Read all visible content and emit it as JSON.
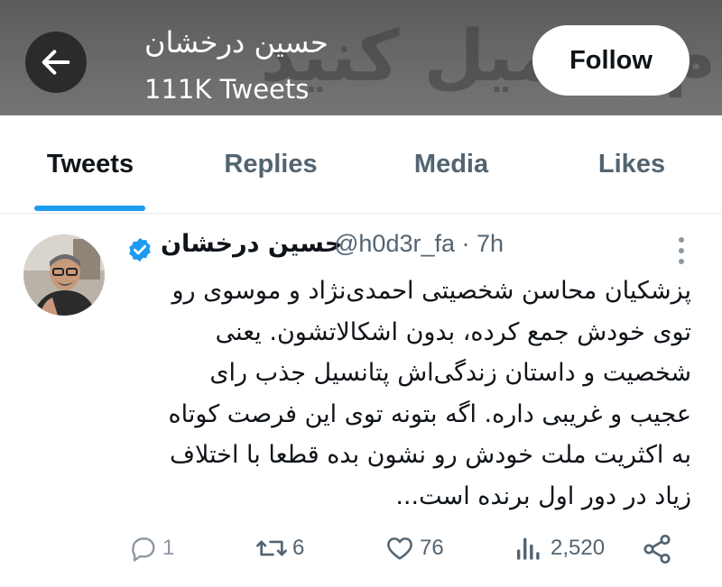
{
  "header": {
    "banner_text": "ام تحمیل کنید",
    "back_icon": "arrow-left-icon",
    "name": "حسین درخشان",
    "tweet_count": "111K Tweets",
    "follow_label": "Follow"
  },
  "tabs": [
    {
      "label": "Tweets",
      "active": true
    },
    {
      "label": "Replies",
      "active": false
    },
    {
      "label": "Media",
      "active": false
    },
    {
      "label": "Likes",
      "active": false
    }
  ],
  "tweet": {
    "author_name": "حسین درخشان",
    "verified": true,
    "handle_time": "@h0d3r_fa · 7h",
    "lines": [
      "پزشکیان محاسن شخصیتی احمدی‌نژاد و موسوی رو",
      "توی خودش جمع کرده، بدون اشکالاتشون. یعنی",
      "شخصیت و داستان زندگی‌اش پتانسیل جذب رای",
      "عجیب و غریبی داره. اگه بتونه توی این فرصت کوتاه",
      "به اکثریت ملت خودش رو نشون بده قطعا با اختلاف",
      "زیاد در دور اول برنده است..."
    ],
    "actions": {
      "replies": "1",
      "retweets": "6",
      "likes": "76",
      "views": "2,520"
    }
  },
  "colors": {
    "accent": "#1d9bf0",
    "text": "#0f1419",
    "muted": "#536471"
  }
}
